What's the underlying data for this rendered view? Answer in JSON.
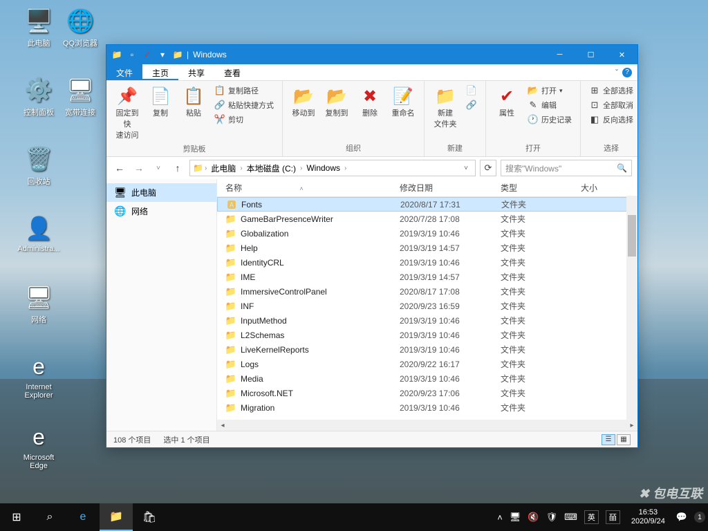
{
  "desktop_icons": [
    {
      "label": "此电脑",
      "glyph": "🖥️"
    },
    {
      "label": "QQ浏览器",
      "glyph": "🌐"
    },
    {
      "label": "控制面板",
      "glyph": "⚙️"
    },
    {
      "label": "宽带连接",
      "glyph": "🖥"
    },
    {
      "label": "回收站",
      "glyph": "🗑️"
    },
    {
      "label": "Administra...",
      "glyph": "👤"
    },
    {
      "label": "网络",
      "glyph": "🖥"
    },
    {
      "label": "Internet Explorer",
      "glyph": "e"
    },
    {
      "label": "Microsoft Edge",
      "glyph": "e"
    }
  ],
  "watermark": "✖ 包电互联",
  "explorer": {
    "title": "Windows",
    "tabs": {
      "file": "文件",
      "home": "主页",
      "share": "共享",
      "view": "查看"
    },
    "ribbon": {
      "pin": "固定到快\n速访问",
      "copy": "复制",
      "paste": "粘贴",
      "copy_path": "复制路径",
      "paste_shortcut": "粘贴快捷方式",
      "cut": "剪切",
      "move_to": "移动到",
      "copy_to": "复制到",
      "delete": "删除",
      "rename": "重命名",
      "new_folder": "新建\n文件夹",
      "properties": "属性",
      "open": "打开",
      "edit": "编辑",
      "history": "历史记录",
      "select_all": "全部选择",
      "select_none": "全部取消",
      "invert": "反向选择",
      "group_clipboard": "剪贴板",
      "group_organize": "组织",
      "group_new": "新建",
      "group_open": "打开",
      "group_select": "选择"
    },
    "breadcrumb": [
      "此电脑",
      "本地磁盘 (C:)",
      "Windows"
    ],
    "search_placeholder": "搜索\"Windows\"",
    "navpane": {
      "this_pc": "此电脑",
      "network": "网络"
    },
    "columns": {
      "name": "名称",
      "date": "修改日期",
      "type": "类型",
      "size": "大小"
    },
    "rows": [
      {
        "name": "Fonts",
        "date": "2020/8/17 17:31",
        "type": "文件夹",
        "selected": true,
        "icon": "🅰"
      },
      {
        "name": "GameBarPresenceWriter",
        "date": "2020/7/28 17:08",
        "type": "文件夹"
      },
      {
        "name": "Globalization",
        "date": "2019/3/19 10:46",
        "type": "文件夹"
      },
      {
        "name": "Help",
        "date": "2019/3/19 14:57",
        "type": "文件夹"
      },
      {
        "name": "IdentityCRL",
        "date": "2019/3/19 10:46",
        "type": "文件夹"
      },
      {
        "name": "IME",
        "date": "2019/3/19 14:57",
        "type": "文件夹"
      },
      {
        "name": "ImmersiveControlPanel",
        "date": "2020/8/17 17:08",
        "type": "文件夹"
      },
      {
        "name": "INF",
        "date": "2020/9/23 16:59",
        "type": "文件夹"
      },
      {
        "name": "InputMethod",
        "date": "2019/3/19 10:46",
        "type": "文件夹"
      },
      {
        "name": "L2Schemas",
        "date": "2019/3/19 10:46",
        "type": "文件夹"
      },
      {
        "name": "LiveKernelReports",
        "date": "2019/3/19 10:46",
        "type": "文件夹"
      },
      {
        "name": "Logs",
        "date": "2020/9/22 16:17",
        "type": "文件夹"
      },
      {
        "name": "Media",
        "date": "2019/3/19 10:46",
        "type": "文件夹"
      },
      {
        "name": "Microsoft.NET",
        "date": "2020/9/23 17:06",
        "type": "文件夹"
      },
      {
        "name": "Migration",
        "date": "2019/3/19 10:46",
        "type": "文件夹"
      }
    ],
    "status": {
      "count": "108 个项目",
      "selected": "选中 1 个项目"
    }
  },
  "taskbar": {
    "time": "16:53",
    "date": "2020/9/24",
    "ime1": "英",
    "ime2": "皕"
  }
}
